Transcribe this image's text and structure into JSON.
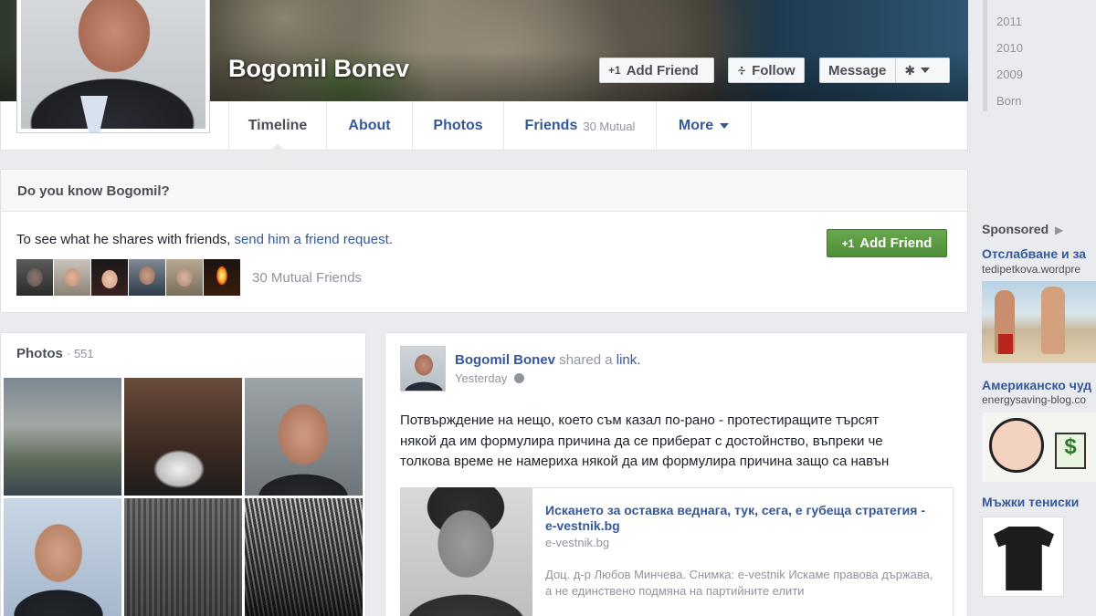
{
  "profile": {
    "name": "Bogomil Bonev",
    "buttons": {
      "add_friend": "Add Friend",
      "follow": "Follow",
      "message": "Message"
    }
  },
  "tabs": [
    {
      "label": "Timeline"
    },
    {
      "label": "About"
    },
    {
      "label": "Photos"
    },
    {
      "label": "Friends",
      "sub": "30 Mutual"
    },
    {
      "label": "More"
    }
  ],
  "timeline_years": [
    "2011",
    "2010",
    "2009",
    "Born"
  ],
  "know_card": {
    "title": "Do you know Bogomil?",
    "text_prefix": "To see what he shares with friends,",
    "text_link": "send him a friend request.",
    "button": "Add Friend",
    "mutual_friends": "30 Mutual Friends"
  },
  "photos_card": {
    "title": "Photos",
    "count": "· 551"
  },
  "post": {
    "author": "Bogomil Bonev",
    "action": "shared a",
    "object": "link.",
    "time": "Yesterday",
    "text_lines": [
      "Потвърждение на нещо, което съм казал по-рано - протестиращите търсят",
      "някой да им формулира причина да се приберат с достойнство, въпреки че",
      "толкова време не намериха някой да им формулира причина защо са навън"
    ],
    "link": {
      "title": "Искането за оставка веднага, тук, сега, е губеща стратегия - e-vestnik.bg",
      "domain": "e-vestnik.bg",
      "description": "Доц. д-р Любов Минчева. Снимка: e-vestnik Искаме правова държава, а не единствено подмяна на партийните елити"
    }
  },
  "sponsored": {
    "title": "Sponsored",
    "ads": [
      {
        "title": "Отслабване и за",
        "domain": "tedipetkova.wordpre"
      },
      {
        "title": "Американско чуд",
        "domain": "energysaving-blog.co"
      },
      {
        "title": "Мъжки тениски",
        "domain": ""
      }
    ]
  },
  "colors": {
    "link": "#365899",
    "green_button": "#5a9e3f",
    "page_bg": "#e9ebee"
  },
  "icons": [
    "add-friend-icon",
    "follow-rss-icon",
    "gear-icon",
    "chevron-down-icon",
    "globe-icon",
    "megaphone-icon"
  ]
}
